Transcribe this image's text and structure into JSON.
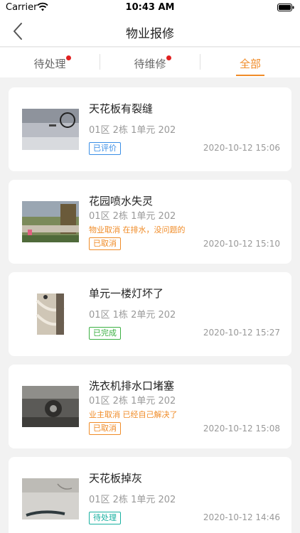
{
  "status_bar": {
    "carrier": "Carrier",
    "time": "10:43 AM"
  },
  "nav": {
    "title": "物业报修",
    "back_icon": "chevron-left-icon"
  },
  "tabs": [
    {
      "label": "待处理",
      "has_dot": true,
      "active": false
    },
    {
      "label": "待维修",
      "has_dot": true,
      "active": false
    },
    {
      "label": "全部",
      "has_dot": false,
      "active": true
    }
  ],
  "colors": {
    "accent": "#f08c28",
    "dot": "#e02020"
  },
  "repairs": [
    {
      "title": "天花板有裂缝",
      "address": "01区 2栋 1单元 202",
      "note": "",
      "status": "已评价",
      "status_color": "blue",
      "time": "2020-10-12 15:06"
    },
    {
      "title": "花园喷水失灵",
      "address": "01区 2栋 1单元 202",
      "note": "物业取消  在排水，没问题的",
      "status": "已取消",
      "status_color": "orange",
      "time": "2020-10-12 15:10"
    },
    {
      "title": "单元一楼灯坏了",
      "address": "01区 1栋 2单元 202",
      "note": "",
      "status": "已完成",
      "status_color": "green",
      "time": "2020-10-12 15:27"
    },
    {
      "title": "洗衣机排水口堵塞",
      "address": "01区 2栋 1单元 202",
      "note": "业主取消  已经自己解决了",
      "status": "已取消",
      "status_color": "orange",
      "time": "2020-10-12 15:08"
    },
    {
      "title": "天花板掉灰",
      "address": "01区 2栋 1单元 202",
      "note": "",
      "status": "待处理",
      "status_color": "teal",
      "time": "2020-10-12 14:46"
    }
  ]
}
